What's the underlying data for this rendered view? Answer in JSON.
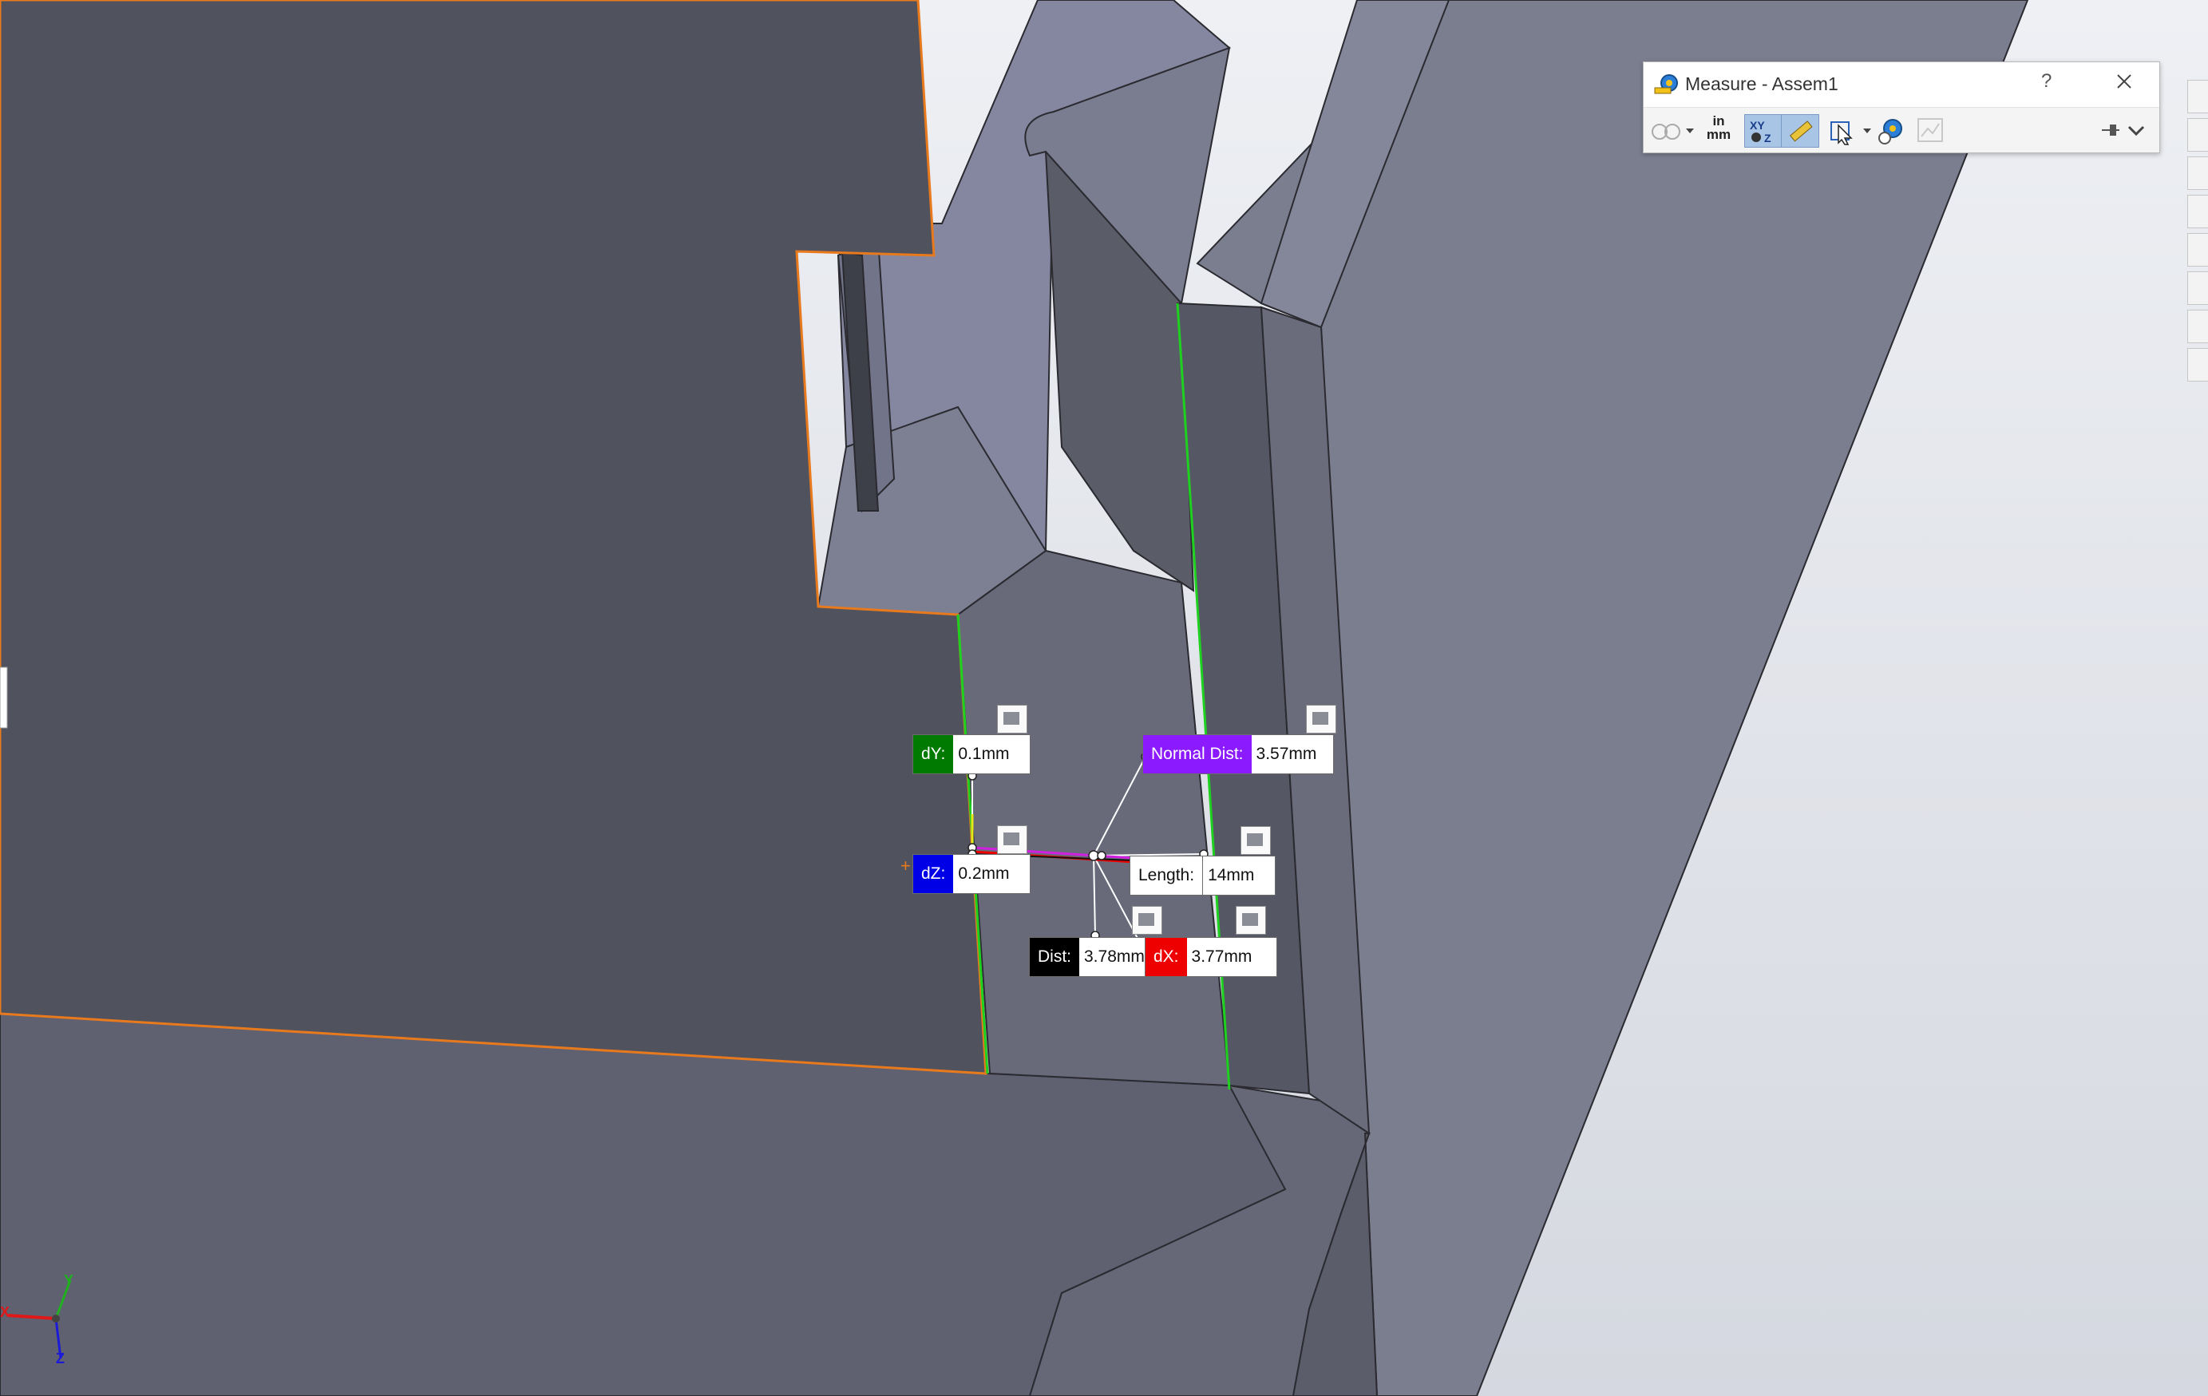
{
  "measure_window": {
    "title": "Measure - Assem1",
    "help": "?",
    "units_in": "in",
    "units_mm": "mm"
  },
  "callouts": {
    "dy": {
      "label": "dY:",
      "value": "0.1mm",
      "color": "#007a00"
    },
    "dz": {
      "label": "dZ:",
      "value": "0.2mm",
      "color": "#0000e6"
    },
    "normal": {
      "label": "Normal Dist:",
      "value": "3.57mm",
      "color": "#8b1aff"
    },
    "length": {
      "label": "Length:",
      "value": "14mm",
      "color": "#ffffff"
    },
    "dist": {
      "label": "Dist:",
      "value": "3.78mm",
      "color": "#000000"
    },
    "dx": {
      "label": "dX:",
      "value": "3.77mm",
      "color": "#ef0000"
    }
  },
  "triad": {
    "x": "X",
    "y": "Y",
    "z": "Z"
  },
  "colors": {
    "face_dark": "#50525d",
    "face_mid": "#5d5f6b",
    "face_light": "#7e8192",
    "edge_selected": "#e87a1d",
    "edge_green": "#1fd11f",
    "background": "#e6e8ed"
  }
}
